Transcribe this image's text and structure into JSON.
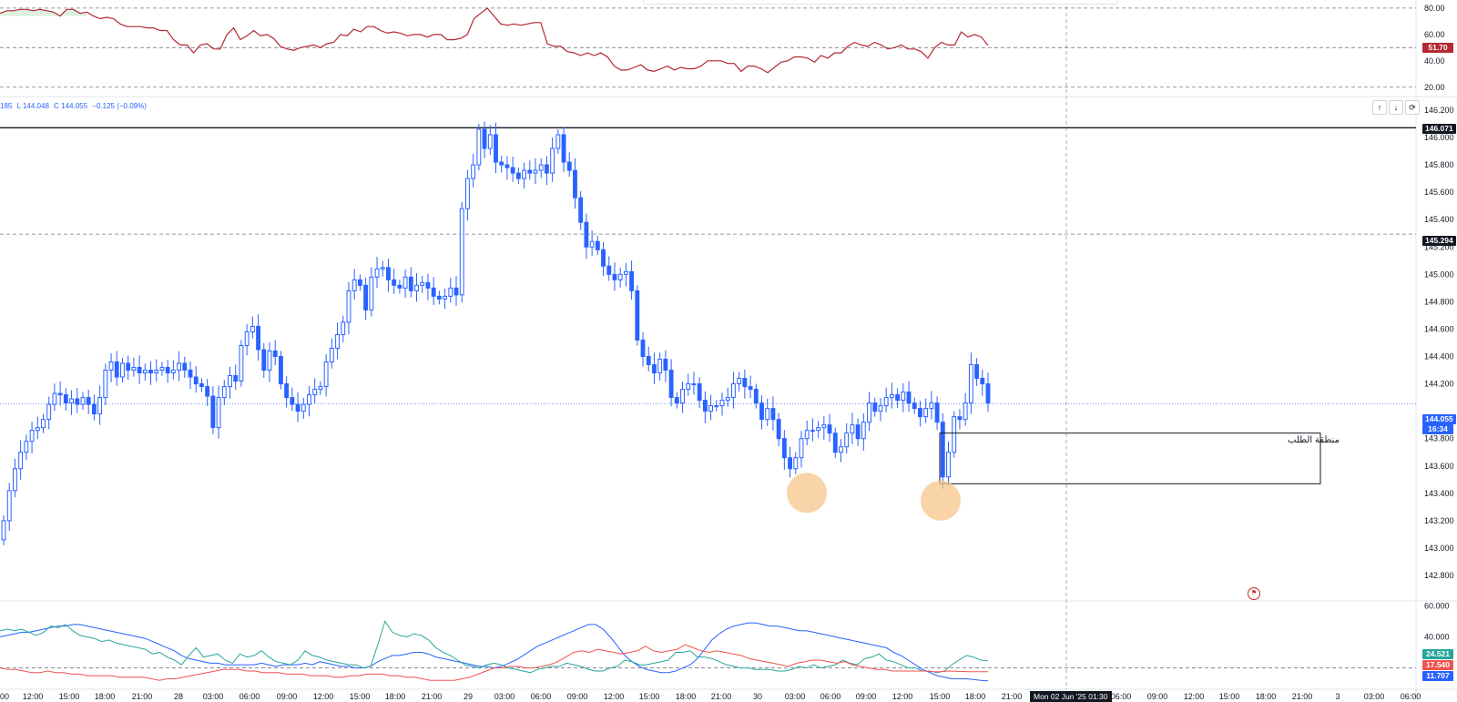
{
  "ohlc_header": {
    "high_fragment": "185",
    "low": "L 144.048",
    "close": "C 144.055",
    "change": "−0.125 (−0.09%)"
  },
  "zone_label": "منطقة الطلب",
  "cursor_time_label": "Mon 02 Jun '25   01:30",
  "nav_buttons": [
    "↑",
    "↓",
    "⟳"
  ],
  "colors": {
    "candle": "#2962ff",
    "rsi": "#b22833",
    "adx": "#2962ff",
    "di_plus": "#26a69a",
    "di_minus": "#ef5350",
    "highlight": "#f7c68c"
  },
  "chart_data": [
    {
      "type": "line",
      "name": "RSI",
      "y_ticks": [
        "80.00",
        "60.00",
        "40.00",
        "20.00"
      ],
      "levels": [
        80,
        50,
        20
      ],
      "current_value": "51.70",
      "ylim": [
        15,
        82
      ],
      "values": [
        76,
        78,
        78,
        79,
        79,
        78,
        79,
        78,
        77,
        74,
        79,
        79,
        76,
        77,
        74,
        72,
        73,
        72,
        68,
        66,
        66,
        66,
        65,
        65,
        63,
        63,
        56,
        52,
        52,
        46,
        52,
        53,
        49,
        49,
        60,
        65,
        56,
        59,
        63,
        59,
        60,
        57,
        51,
        49,
        48,
        50,
        51,
        52,
        50,
        53,
        54,
        60,
        59,
        64,
        62,
        66,
        66,
        63,
        61,
        62,
        61,
        59,
        60,
        60,
        58,
        60,
        60,
        56,
        56,
        57,
        60,
        72,
        76,
        80,
        74,
        68,
        67,
        68,
        67,
        68,
        69,
        69,
        53,
        51,
        51,
        47,
        46,
        44,
        46,
        44,
        46,
        43,
        36,
        33,
        33,
        35,
        37,
        33,
        32,
        34,
        36,
        33,
        35,
        34,
        34,
        36,
        40,
        40,
        40,
        38,
        38,
        32,
        36,
        36,
        34,
        31,
        35,
        39,
        40,
        43,
        43,
        42,
        39,
        44,
        42,
        46,
        46,
        51,
        54,
        52,
        51,
        54,
        52,
        49,
        50,
        52,
        49,
        49,
        47,
        42,
        50,
        54,
        52,
        52,
        62,
        58,
        60,
        58,
        51.7
      ]
    },
    {
      "type": "candlestick",
      "name": "Price",
      "y_ticks": [
        "146.200",
        "146.000",
        "145.800",
        "145.600",
        "145.400",
        "145.200",
        "145.000",
        "144.800",
        "144.600",
        "144.400",
        "144.200",
        "143.800",
        "143.600",
        "143.400",
        "143.200",
        "143.000",
        "142.800"
      ],
      "x_ticks": [
        "00",
        "12:00",
        "15:00",
        "18:00",
        "21:00",
        "28",
        "03:00",
        "06:00",
        "09:00",
        "12:00",
        "15:00",
        "18:00",
        "21:00",
        "29",
        "03:00",
        "06:00",
        "09:00",
        "12:00",
        "15:00",
        "18:00",
        "21:00",
        "30",
        "03:00",
        "06:00",
        "09:00",
        "12:00",
        "15:00",
        "18:00",
        "21:00",
        "06:00",
        "09:00",
        "12:00",
        "15:00",
        "18:00",
        "21:00",
        "3",
        "03:00",
        "06:00"
      ],
      "ylim": [
        142.8,
        146.25
      ],
      "resistance": "146.071",
      "dashed_level": "145.294",
      "current_price": "144.055",
      "countdown": "16:34",
      "demand_zone": {
        "high": 143.84,
        "low": 143.47,
        "label": "منطقة الطلب"
      },
      "highlighted_lows": [
        143.47,
        143.4
      ],
      "close": [
        143.2,
        143.42,
        143.58,
        143.7,
        143.78,
        143.86,
        143.88,
        143.94,
        144.05,
        144.13,
        144.12,
        144.06,
        144.09,
        144.05,
        144.1,
        144.05,
        143.98,
        144.1,
        144.3,
        144.36,
        144.25,
        144.35,
        144.3,
        144.32,
        144.28,
        144.3,
        144.28,
        144.3,
        144.32,
        144.28,
        144.3,
        144.35,
        144.3,
        144.25,
        144.2,
        144.18,
        144.11,
        143.88,
        144.1,
        144.18,
        144.26,
        144.22,
        144.48,
        144.58,
        144.62,
        144.45,
        144.3,
        144.44,
        144.4,
        144.2,
        144.1,
        144.05,
        144.0,
        144.05,
        144.12,
        144.16,
        144.18,
        144.36,
        144.46,
        144.56,
        144.65,
        144.88,
        144.96,
        144.92,
        144.74,
        144.98,
        145.04,
        145.05,
        144.96,
        144.92,
        144.9,
        144.98,
        144.88,
        144.92,
        144.94,
        144.9,
        144.84,
        144.82,
        144.84,
        144.9,
        144.85,
        145.48,
        145.7,
        145.8,
        146.06,
        145.92,
        146.02,
        145.82,
        145.8,
        145.78,
        145.74,
        145.7,
        145.76,
        145.74,
        145.76,
        145.8,
        145.74,
        145.92,
        146.02,
        145.82,
        145.76,
        145.56,
        145.38,
        145.2,
        145.24,
        145.18,
        145.06,
        145.0,
        144.96,
        145.0,
        145.02,
        144.88,
        144.52,
        144.4,
        144.34,
        144.28,
        144.38,
        144.3,
        144.1,
        144.06,
        144.16,
        144.2,
        144.2,
        144.08,
        144.0,
        144.04,
        144.04,
        144.08,
        144.1,
        144.2,
        144.24,
        144.18,
        144.16,
        144.06,
        143.94,
        144.02,
        143.94,
        143.8,
        143.66,
        143.58,
        143.66,
        143.8,
        143.86,
        143.86,
        143.88,
        143.9,
        143.84,
        143.7,
        143.74,
        143.84,
        143.9,
        143.8,
        143.92,
        144.06,
        144.0,
        144.04,
        144.1,
        144.12,
        144.08,
        144.14,
        144.06,
        144.02,
        143.96,
        144.02,
        144.06,
        143.92,
        143.52,
        143.7,
        143.96,
        143.94,
        144.06,
        144.34,
        144.24,
        144.2,
        144.06
      ]
    },
    {
      "type": "line",
      "name": "DMI / ADX",
      "y_ticks": [
        "60.000",
        "40.000"
      ],
      "level": 20,
      "ylim": [
        8,
        62
      ],
      "series": [
        {
          "color": "#2962ff",
          "current_value": "11.707",
          "values": [
            40,
            41,
            42,
            43,
            43,
            44,
            45,
            46,
            47,
            47,
            48,
            48,
            47,
            46,
            45,
            44,
            43,
            42,
            41,
            40,
            39,
            37,
            35,
            33,
            31,
            28,
            26,
            25,
            24,
            23,
            23,
            22,
            22,
            22,
            22,
            22,
            23,
            22,
            21,
            22,
            22,
            22,
            23,
            22,
            24,
            23,
            22,
            21,
            21,
            20,
            20,
            21,
            24,
            26,
            28,
            28,
            29,
            30,
            30,
            29,
            27,
            26,
            25,
            24,
            23,
            22,
            21,
            21,
            20,
            21,
            23,
            25,
            28,
            31,
            34,
            36,
            38,
            40,
            42,
            44,
            46,
            48,
            48,
            45,
            40,
            34,
            28,
            24,
            21,
            19,
            18,
            17,
            17,
            18,
            20,
            22,
            26,
            32,
            38,
            42,
            45,
            47,
            48,
            49,
            49,
            48,
            47,
            47,
            46,
            45,
            44,
            44,
            43,
            42,
            41,
            40,
            39,
            38,
            37,
            36,
            35,
            34,
            33,
            30,
            28,
            25,
            22,
            19,
            17,
            15,
            14,
            13,
            13,
            13,
            12.5,
            12,
            11.7
          ]
        },
        {
          "color": "#26a69a",
          "current_value": "24.521",
          "values": [
            44,
            45,
            44,
            45,
            43,
            41,
            43,
            47,
            46,
            48,
            44,
            41,
            40,
            39,
            37,
            38,
            36,
            35,
            34,
            33,
            32,
            29,
            30,
            27,
            25,
            22,
            28,
            33,
            27,
            28,
            29,
            25,
            23,
            29,
            27,
            28,
            31,
            27,
            24,
            23,
            22,
            25,
            31,
            28,
            27,
            25,
            24,
            23,
            22,
            22,
            20,
            21,
            35,
            50,
            43,
            41,
            40,
            42,
            41,
            38,
            33,
            30,
            28,
            25,
            22,
            21,
            20,
            22,
            23,
            22,
            20,
            19,
            18,
            17,
            19,
            20,
            21,
            21,
            23,
            22,
            21,
            19,
            18,
            18,
            20,
            21,
            25,
            24,
            22,
            22,
            23,
            24,
            25,
            30,
            30,
            31,
            27,
            27,
            26,
            24,
            22,
            21,
            20,
            20,
            19,
            19,
            19,
            18,
            18,
            19,
            21,
            20,
            22,
            20,
            21,
            22,
            25,
            23,
            22,
            26,
            27,
            29,
            25,
            24,
            22,
            20,
            20,
            18,
            18,
            17,
            18,
            22,
            25,
            28,
            27,
            25,
            24.5
          ]
        },
        {
          "color": "#ef5350",
          "current_value": "17.540",
          "values": [
            20,
            19,
            19,
            18,
            17,
            17,
            18,
            17,
            17,
            16,
            16,
            15,
            15,
            15,
            15,
            14,
            14,
            14,
            14,
            13,
            12,
            13,
            13,
            14,
            15,
            16,
            17,
            18,
            19,
            19,
            19,
            18,
            18,
            17,
            17,
            17,
            16,
            16,
            16,
            15,
            15,
            15,
            14,
            14,
            15,
            15,
            16,
            16,
            16,
            15,
            15,
            14,
            14,
            13,
            12,
            12,
            12,
            12,
            13,
            14,
            16,
            18,
            20,
            20,
            21,
            21,
            20,
            20,
            21,
            22,
            24,
            27,
            30,
            31,
            30,
            32,
            31,
            30,
            29,
            30,
            31,
            34,
            31,
            30,
            31,
            32,
            35,
            33,
            31,
            30,
            31,
            30,
            29,
            28,
            26,
            25,
            24,
            23,
            22,
            21,
            23,
            24,
            25,
            25,
            24,
            23,
            24,
            22,
            21,
            20,
            19,
            19,
            18,
            18,
            18,
            18,
            18,
            17.5,
            17.5,
            18,
            17.8,
            17.6,
            17.5,
            17.5,
            17.54
          ]
        }
      ]
    }
  ]
}
